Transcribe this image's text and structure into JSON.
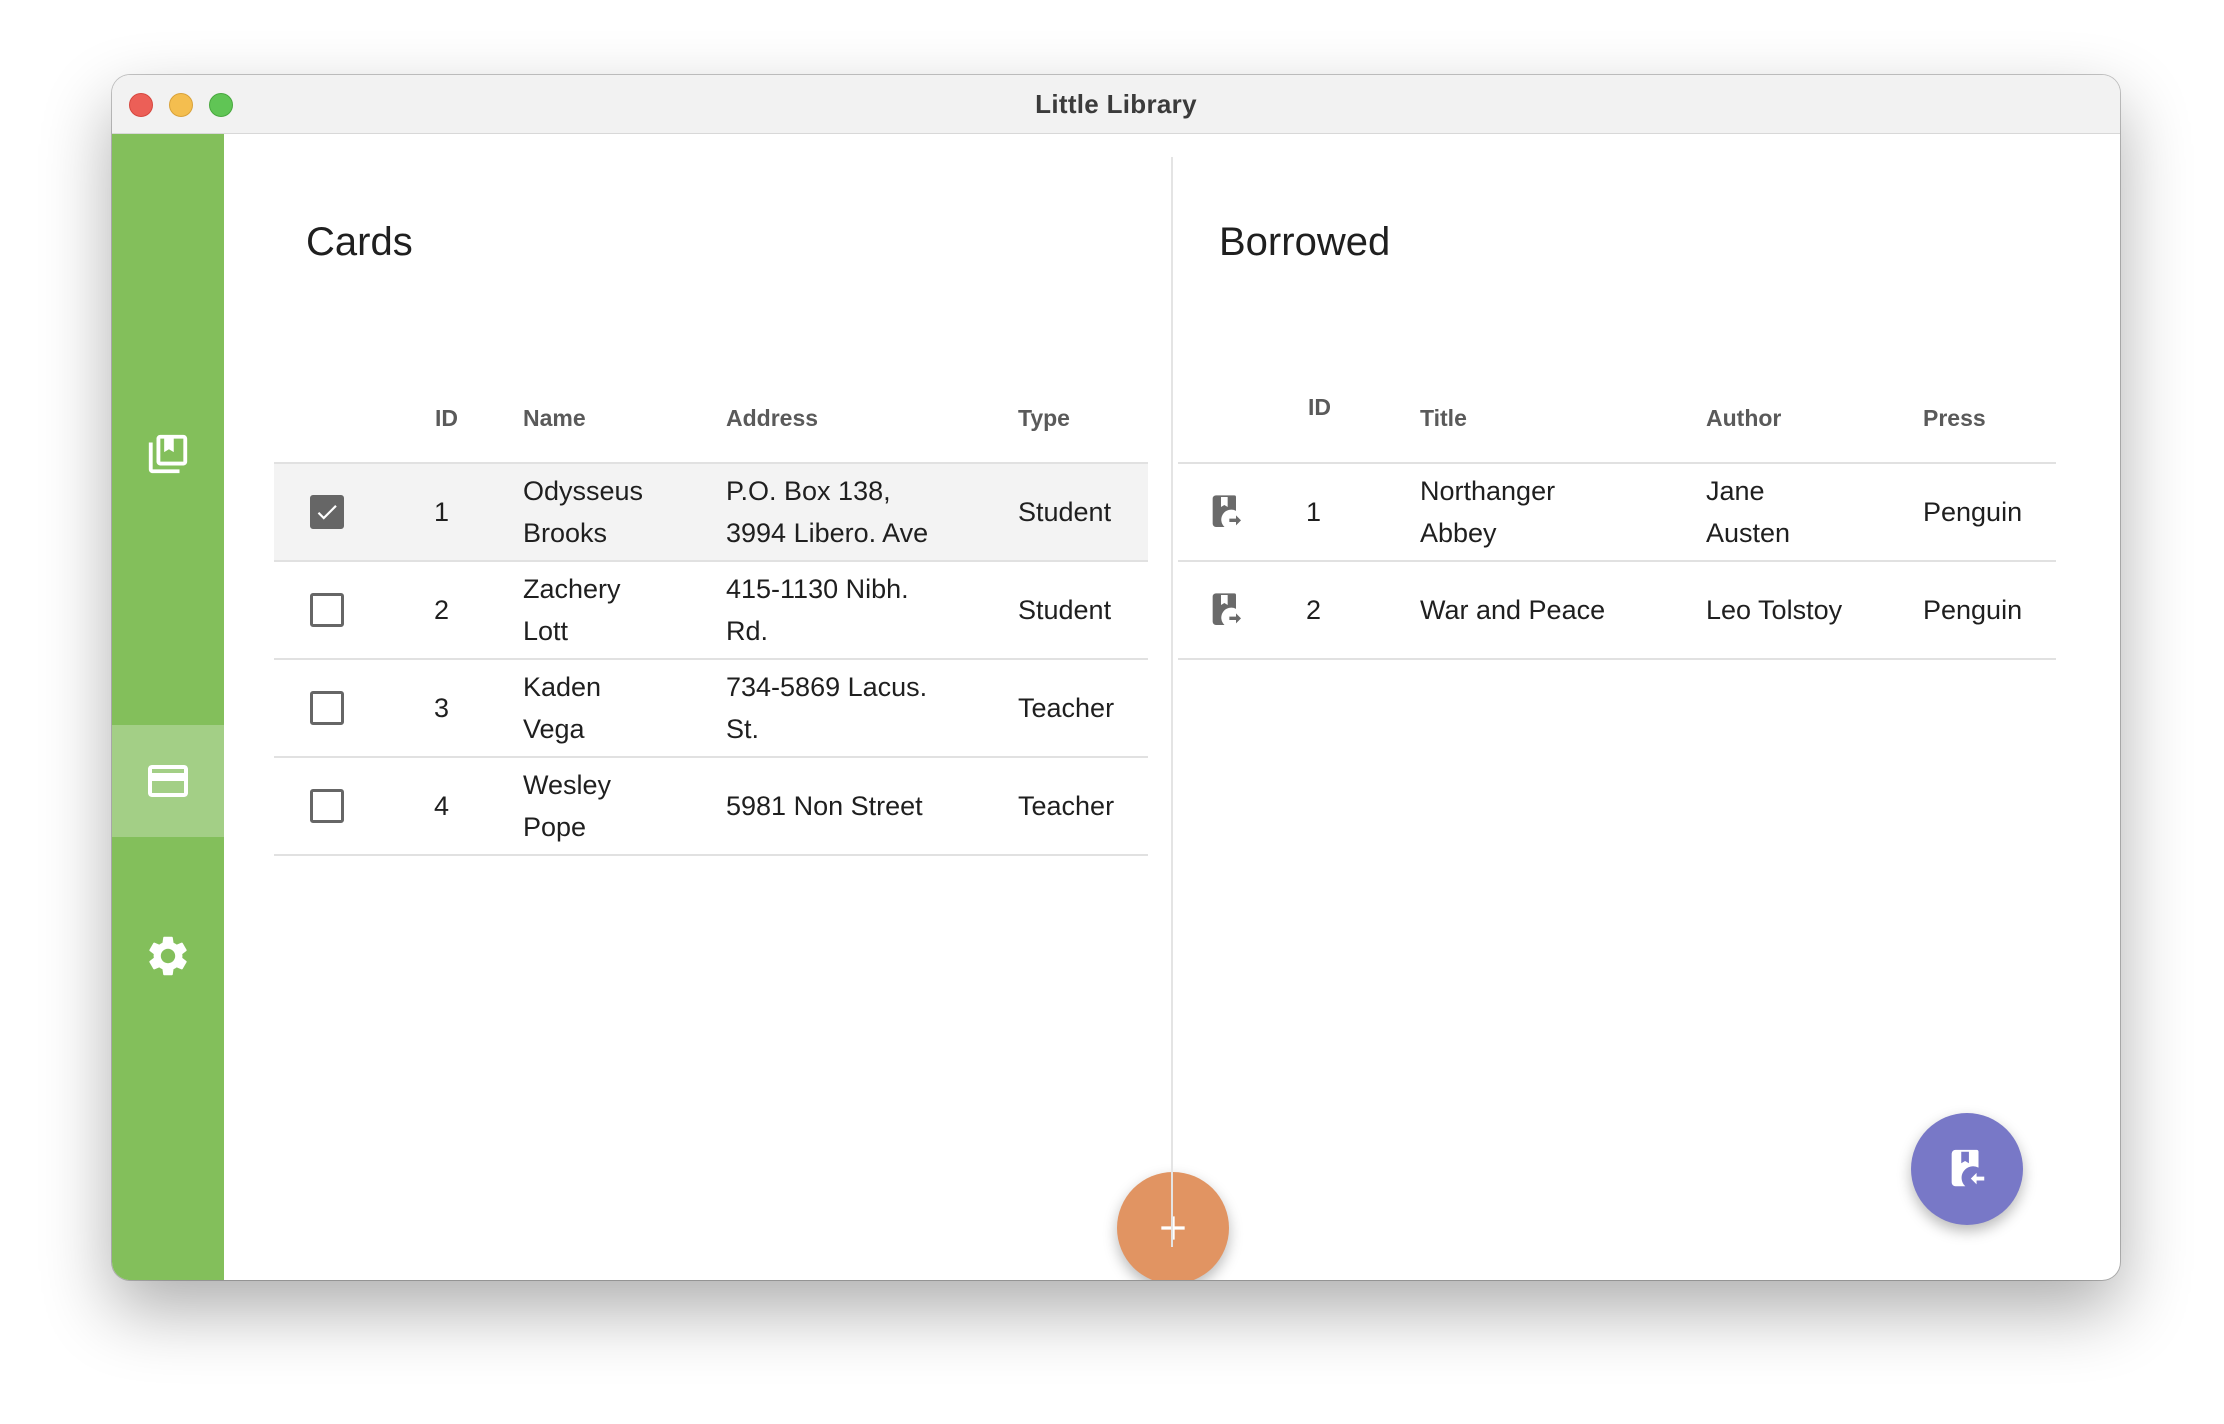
{
  "window": {
    "title": "Little Library"
  },
  "rail": {
    "items": [
      {
        "name": "books",
        "icon": "books-icon",
        "active": false
      },
      {
        "name": "cards",
        "icon": "credit-card-icon",
        "active": true
      },
      {
        "name": "settings",
        "icon": "gear-icon",
        "active": false
      }
    ]
  },
  "cards": {
    "title": "Cards",
    "columns": {
      "id": "ID",
      "name": "Name",
      "address": "Address",
      "type": "Type"
    },
    "rows": [
      {
        "checked": true,
        "id": "1",
        "name1": "Odysseus",
        "name2": "Brooks",
        "addr1": "P.O. Box 138,",
        "addr2": "3994 Libero. Ave",
        "type": "Student"
      },
      {
        "checked": false,
        "id": "2",
        "name1": "Zachery",
        "name2": "Lott",
        "addr1": "415-1130 Nibh.",
        "addr2": "Rd.",
        "type": "Student"
      },
      {
        "checked": false,
        "id": "3",
        "name1": "Kaden",
        "name2": "Vega",
        "addr1": "734-5869 Lacus.",
        "addr2": "St.",
        "type": "Teacher"
      },
      {
        "checked": false,
        "id": "4",
        "name1": "Wesley",
        "name2": "Pope",
        "addr1": "5981 Non Street",
        "addr2": "",
        "type": "Teacher"
      }
    ],
    "fab_icon": "plus-icon"
  },
  "borrowed": {
    "title": "Borrowed",
    "columns": {
      "id": "ID",
      "title": "Title",
      "author": "Author",
      "press": "Press"
    },
    "rows": [
      {
        "id": "1",
        "title1": "Northanger",
        "title2": "Abbey",
        "author1": "Jane",
        "author2": "Austen",
        "press": "Penguin"
      },
      {
        "id": "2",
        "title1": "War and Peace",
        "title2": "",
        "author1": "Leo Tolstoy",
        "author2": "",
        "press": "Penguin"
      }
    ],
    "fab_icon": "book-return-icon"
  },
  "colors": {
    "rail": "#83bf5b",
    "rail_active": "#a3cf86",
    "fab_add": "#e19462",
    "fab_return": "#7878c7"
  }
}
